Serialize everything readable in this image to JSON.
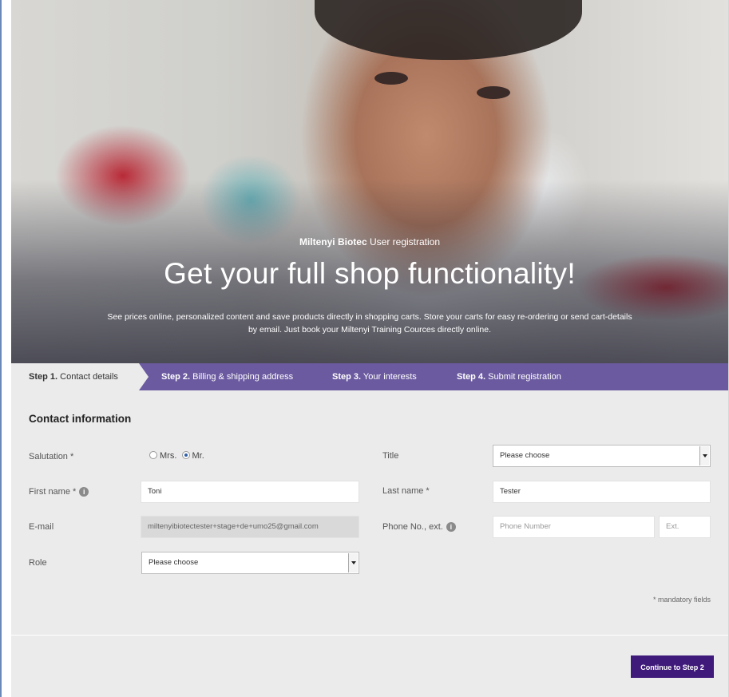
{
  "hero": {
    "brand_bold": "Miltenyi Biotec",
    "brand_rest": " User registration",
    "title": "Get your full shop functionality!",
    "description_line1": "See prices online, personalized content and save products directly in shopping carts. Store your carts for easy re-ordering or send cart-details",
    "description_line2": "by email. Just book your Miltenyi Training Cources directly online."
  },
  "steps": [
    {
      "num": "Step 1.",
      "label": " Contact details",
      "active": true
    },
    {
      "num": "Step 2.",
      "label": " Billing & shipping address",
      "active": false
    },
    {
      "num": "Step 3.",
      "label": " Your interests",
      "active": false
    },
    {
      "num": "Step 4.",
      "label": " Submit registration",
      "active": false
    }
  ],
  "form": {
    "section_title": "Contact information",
    "salutation": {
      "label": "Salutation *",
      "option_mrs": "Mrs.",
      "option_mr": "Mr.",
      "selected": "Mr."
    },
    "title": {
      "label": "Title",
      "value": "Please choose"
    },
    "first_name": {
      "label": "First name *",
      "value": "Toni"
    },
    "last_name": {
      "label": "Last name *",
      "value": "Tester"
    },
    "email": {
      "label": "E-mail",
      "value": "miltenyibiotectester+stage+de+umo25@gmail.com"
    },
    "phone": {
      "label": "Phone No., ext.",
      "placeholder": "Phone Number",
      "ext_placeholder": "Ext."
    },
    "role": {
      "label": "Role",
      "value": "Please choose"
    },
    "mandatory_note": "* mandatory fields",
    "continue_label": "Continue to Step 2"
  },
  "colors": {
    "steps_bar": "#6b5aa0",
    "active_step_bg": "#ebebeb",
    "continue_button": "#3f1a7a",
    "form_bg": "#ebebeb"
  }
}
